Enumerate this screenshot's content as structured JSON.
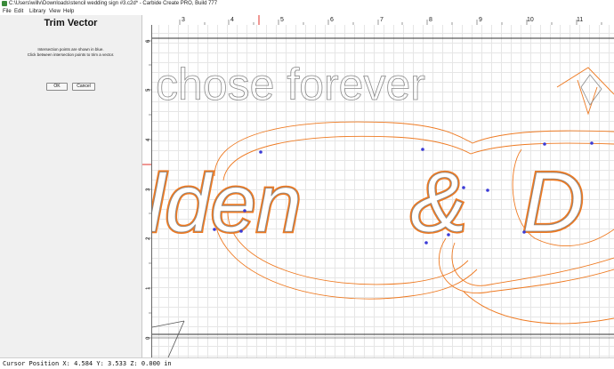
{
  "window": {
    "title": "C:\\Users\\willv\\Downloads\\stencil wedding sign #3.c2d* - Carbide Create PRO, Build 777"
  },
  "menu": {
    "items": [
      "File",
      "Edit",
      "Library",
      "View",
      "Help"
    ]
  },
  "panel": {
    "title": "Trim Vector",
    "line1": "Intersection points are shown in blue.",
    "line2": "Click between intersection points to trim a vector.",
    "ok_label": "OK",
    "cancel_label": "Cancel"
  },
  "rulers": {
    "top_ticks": [
      "3",
      "4",
      "5",
      "6",
      "7",
      "8",
      "9",
      "10",
      "11"
    ],
    "left_ticks": [
      "6",
      "5",
      "4",
      "3",
      "2",
      "1",
      "0"
    ]
  },
  "canvas": {
    "text_top": "chose forever",
    "text_left": "lden",
    "text_amp": "&",
    "text_right": "D",
    "colors": {
      "toolpath": "#ee7a22",
      "vector": "#8a8a8a",
      "intersection": "#3b3bd6",
      "cursor_marker": "#e0302a"
    }
  },
  "status": {
    "text": "Cursor Position X: 4.584 Y: 3.533 Z: 0.000 in"
  }
}
